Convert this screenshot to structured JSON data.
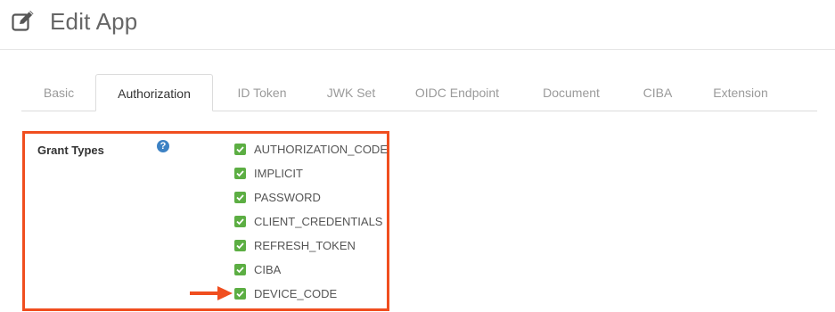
{
  "header": {
    "title": "Edit App",
    "icon": "edit-icon"
  },
  "tabs": [
    {
      "label": "Basic",
      "active": false
    },
    {
      "label": "Authorization",
      "active": true
    },
    {
      "label": "ID Token",
      "active": false
    },
    {
      "label": "JWK Set",
      "active": false
    },
    {
      "label": "OIDC Endpoint",
      "active": false
    },
    {
      "label": "Document",
      "active": false
    },
    {
      "label": "CIBA",
      "active": false
    },
    {
      "label": "Extension",
      "active": false
    }
  ],
  "grant_types": {
    "label": "Grant Types",
    "help_icon": "question-circle-icon",
    "options": [
      {
        "label": "AUTHORIZATION_CODE",
        "checked": true
      },
      {
        "label": "IMPLICIT",
        "checked": true
      },
      {
        "label": "PASSWORD",
        "checked": true
      },
      {
        "label": "CLIENT_CREDENTIALS",
        "checked": true
      },
      {
        "label": "REFRESH_TOKEN",
        "checked": true
      },
      {
        "label": "CIBA",
        "checked": true
      },
      {
        "label": "DEVICE_CODE",
        "checked": true
      }
    ]
  },
  "colors": {
    "highlight_border": "#f04e1f",
    "checkbox": "#5cae43",
    "help_icon": "#3d82c4",
    "arrow": "#f04e1f"
  }
}
